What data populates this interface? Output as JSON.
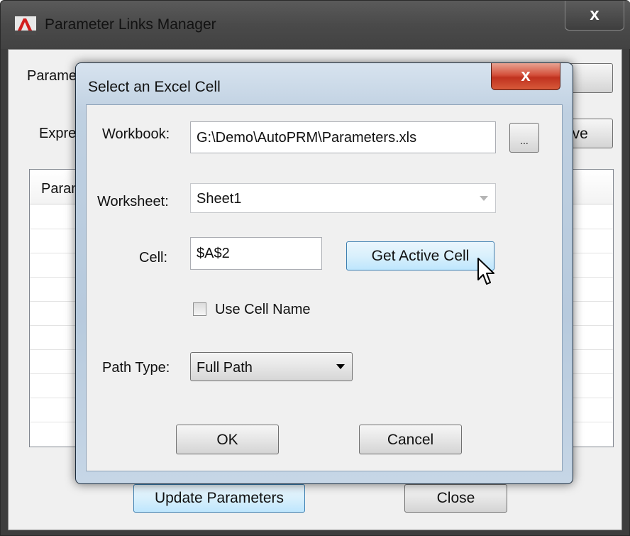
{
  "outer_window": {
    "title": "Parameter Links Manager",
    "close_glyph": "x",
    "param_label_partial": "Parame",
    "expr_label_partial": "Expre",
    "add_button_partial": "d",
    "remove_button_partial": "ove",
    "grid_header_partial": "Paran",
    "update_button": "Update Parameters",
    "close_button": "Close"
  },
  "dialog": {
    "title": "Select an Excel Cell",
    "close_glyph": "x",
    "workbook_label": "Workbook:",
    "workbook_value": "G:\\Demo\\AutoPRM\\Parameters.xls",
    "browse_label": "...",
    "worksheet_label": "Worksheet:",
    "worksheet_value": "Sheet1",
    "cell_label": "Cell:",
    "cell_value": "$A$2",
    "get_active_cell_button": "Get Active Cell",
    "use_cell_name_label": "Use Cell Name",
    "use_cell_name_checked": false,
    "path_type_label": "Path Type:",
    "path_type_value": "Full Path",
    "ok_button": "OK",
    "cancel_button": "Cancel"
  },
  "icons": {
    "app_icon": "autocad-icon",
    "cursor": "mouse-pointer-icon"
  },
  "colors": {
    "close_red": "#c0321f",
    "focus_blue": "#3c7fb1",
    "dialog_frame": "#bfd0e1",
    "outer_frame": "#3d3d3d"
  }
}
